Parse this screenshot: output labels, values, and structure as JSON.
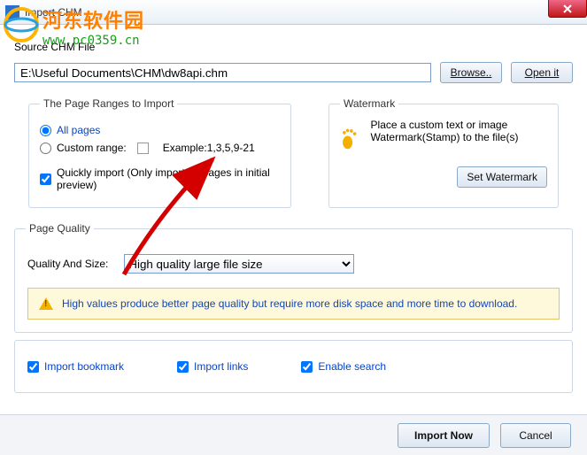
{
  "window": {
    "title": "Import CHM"
  },
  "overlay": {
    "brand": "河东软件园",
    "url": "www.pc0359.cn"
  },
  "source": {
    "legend": "Source CHM File",
    "path": "E:\\Useful Documents\\CHM\\dw8api.chm",
    "browse": "Browse..",
    "open": "Open it"
  },
  "ranges": {
    "legend": "The Page Ranges to Import",
    "all": "All pages",
    "custom_label": "Custom range:",
    "custom_value": "",
    "example": "Example:1,3,5,9-21",
    "quick": "Quickly import (Only import 10 pages in  initial  preview)"
  },
  "watermark": {
    "legend": "Watermark",
    "desc": "Place a custom text or image Watermark(Stamp) to the file(s)",
    "button": "Set Watermark"
  },
  "quality": {
    "legend": "Page Quality",
    "label": "Quality And Size:",
    "selected": "High quality large file size",
    "info": "High values produce better page quality but require more disk space and more time to download."
  },
  "options": {
    "bookmark": "Import bookmark",
    "links": "Import links",
    "search": "Enable search"
  },
  "footer": {
    "import": "Import Now",
    "cancel": "Cancel"
  }
}
